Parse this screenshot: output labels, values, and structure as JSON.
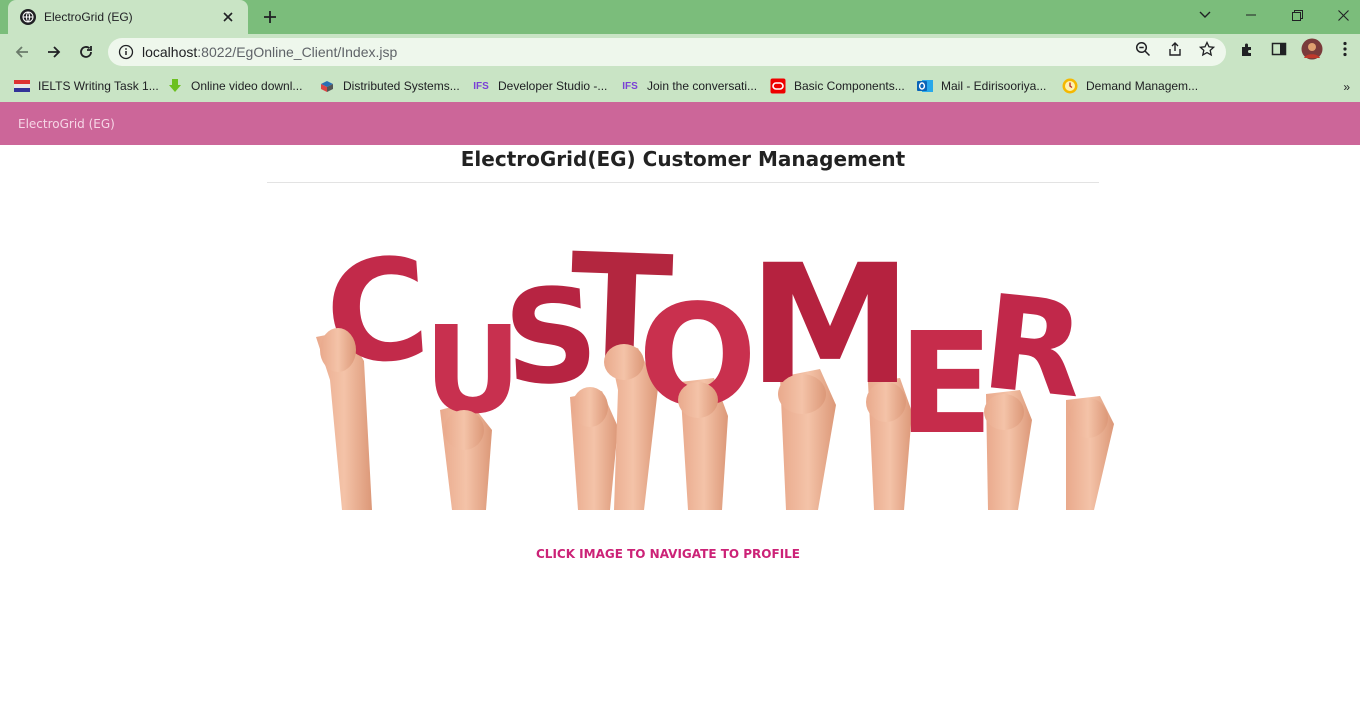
{
  "browser": {
    "tab_title": "ElectroGrid (EG)",
    "url_host": "localhost",
    "url_rest": ":8022/EgOnline_Client/Index.jsp",
    "bookmarks": [
      {
        "label": "IELTS Writing Task 1...",
        "icon": "flag-icon"
      },
      {
        "label": "Online video downl...",
        "icon": "download-arrow-icon"
      },
      {
        "label": "Distributed Systems...",
        "icon": "cube-icon"
      },
      {
        "label": "Developer Studio -...",
        "icon": "ifs-logo-icon"
      },
      {
        "label": "Join the conversati...",
        "icon": "ifs-logo-icon"
      },
      {
        "label": "Basic Components...",
        "icon": "oracle-logo-icon"
      },
      {
        "label": "Mail - Edirisooriya...",
        "icon": "outlook-icon"
      },
      {
        "label": "Demand Managem...",
        "icon": "clock-logo-icon"
      }
    ],
    "bookmarks_more": "»"
  },
  "page": {
    "brand": "ElectroGrid (EG)",
    "title": "ElectroGrid(EG) Customer Management",
    "hero_word": "CUSTOMER",
    "caption": "CLICK IMAGE TO NAVIGATE TO PROFILE"
  },
  "colors": {
    "tabstrip": "#7bbd7b",
    "toolbar": "#c9e4c5",
    "navbar": "#cc6699",
    "letters": "#c22a4a",
    "caption": "#cc2277"
  }
}
